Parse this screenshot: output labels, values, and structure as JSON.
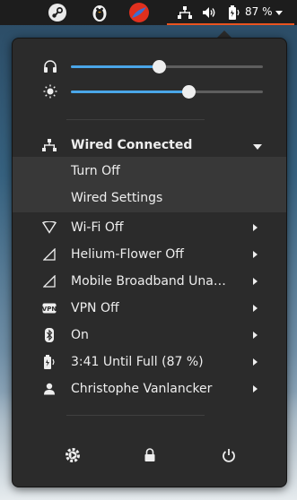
{
  "topbar": {
    "apps": [
      {
        "name": "steam-icon"
      },
      {
        "name": "tux-icon"
      },
      {
        "name": "app-red-icon"
      }
    ],
    "status": {
      "network_icon": "wired-network-icon",
      "volume_icon": "volume-icon",
      "battery_icon": "battery-charging-icon",
      "battery_percent": "87 %"
    },
    "accent": "#e95420"
  },
  "sliders": {
    "volume": {
      "icon": "headphones-icon",
      "level": 0.46
    },
    "brightness": {
      "icon": "brightness-icon",
      "level": 0.61
    },
    "accent": "#4aa6e8"
  },
  "wired": {
    "title": "Wired Connected",
    "submenu": [
      "Turn Off",
      "Wired Settings"
    ]
  },
  "items": [
    {
      "icon": "wifi-icon",
      "label": "Wi-Fi Off"
    },
    {
      "icon": "signal-icon",
      "label": "Helium-Flower Off"
    },
    {
      "icon": "mobile-broadband-icon",
      "label": "Mobile Broadband Una…"
    },
    {
      "icon": "vpn-icon",
      "label": "VPN Off"
    },
    {
      "icon": "bluetooth-icon",
      "label": "On"
    },
    {
      "icon": "battery-charging-icon",
      "label": "3:41 Until Full (87 %)"
    },
    {
      "icon": "user-icon",
      "label": "Christophe Vanlancker"
    }
  ],
  "actions": [
    {
      "icon": "settings-icon"
    },
    {
      "icon": "lock-icon"
    },
    {
      "icon": "power-icon"
    }
  ]
}
